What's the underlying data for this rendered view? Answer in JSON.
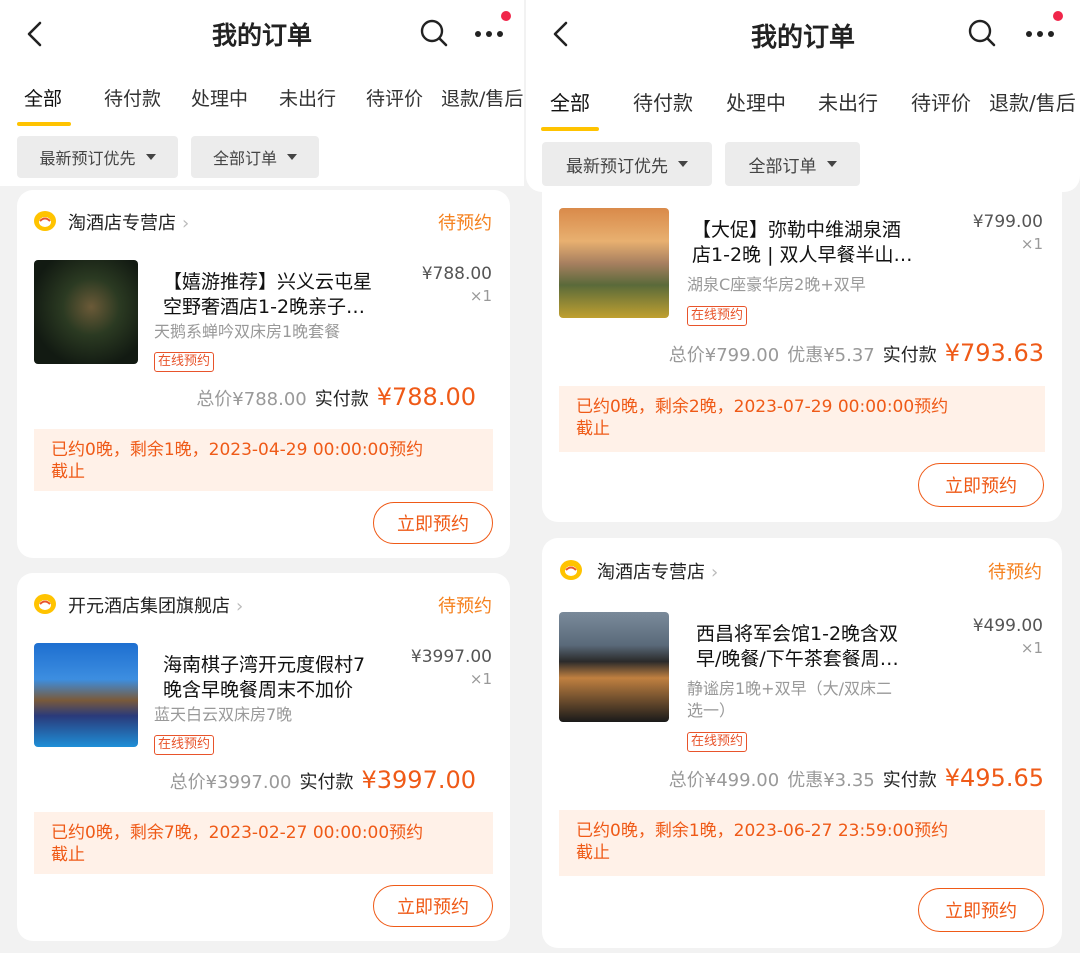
{
  "header": {
    "title": "我的订单",
    "tabs": [
      "全部",
      "待付款",
      "处理中",
      "未出行",
      "待评价",
      "退款/售后"
    ],
    "filters": [
      "最新预订优先",
      "全部订单"
    ]
  },
  "left_orders": [
    {
      "store": "淘酒店专营店",
      "status": "待预约",
      "title_line1": "【嬉游推荐】兴义云屯星",
      "title_line2": "空野奢酒店1-2晚亲子…",
      "room": "天鹅系蝉吟双床房1晚套餐",
      "tag": "在线预约",
      "price": "¥788.00",
      "qty": "×1",
      "total": "总价¥788.00",
      "pay_label": "实付款",
      "pay": "¥788.00",
      "notice_line1": "已约0晚，剩余1晚，2023-04-29 00:00:00预约",
      "notice_line2": "截止",
      "button": "立即预约"
    },
    {
      "store": "开元酒店集团旗舰店",
      "status": "待预约",
      "title_line1": "海南棋子湾开元度假村7",
      "title_line2": "晚含早晚餐周末不加价",
      "room": "蓝天白云双床房7晚",
      "tag": "在线预约",
      "price": "¥3997.00",
      "qty": "×1",
      "total": "总价¥3997.00",
      "pay_label": "实付款",
      "pay": "¥3997.00",
      "notice_line1": "已约0晚，剩余7晚，2023-02-27 00:00:00预约",
      "notice_line2": "截止",
      "button": "立即预约"
    }
  ],
  "right_orders": [
    {
      "title_line1": "【大促】弥勒中维湖泉酒",
      "title_line2": "店1-2晚 | 双人早餐半山…",
      "room": "湖泉C座豪华房2晚+双早",
      "tag": "在线预约",
      "price": "¥799.00",
      "qty": "×1",
      "total": "总价¥799.00",
      "discount": "优惠¥5.37",
      "pay_label": "实付款",
      "pay": "¥793.63",
      "notice_line1": "已约0晚，剩余2晚，2023-07-29 00:00:00预约",
      "notice_line2": "截止",
      "button": "立即预约"
    },
    {
      "store": "淘酒店专营店",
      "status": "待预约",
      "title_line1": "西昌将军会馆1-2晚含双",
      "title_line2": "早/晚餐/下午茶套餐周…",
      "room_line1": "静谧房1晚+双早（大/双床二",
      "room_line2": "选一）",
      "tag": "在线预约",
      "price": "¥499.00",
      "qty": "×1",
      "total": "总价¥499.00",
      "discount": "优惠¥3.35",
      "pay_label": "实付款",
      "pay": "¥495.65",
      "notice_line1": "已约0晚，剩余1晚，2023-06-27 23:59:00预约",
      "notice_line2": "截止",
      "button": "立即预约"
    }
  ],
  "colors": {
    "accent": "#ffc300",
    "price": "#ef5a17",
    "status": "#f58220",
    "notify_bg": "#fff1e8"
  },
  "icons": [
    "back-arrow-icon",
    "search-icon",
    "more-icon",
    "notification-dot",
    "store-logo-icon",
    "chevron-right-icon",
    "caret-down-icon"
  ]
}
